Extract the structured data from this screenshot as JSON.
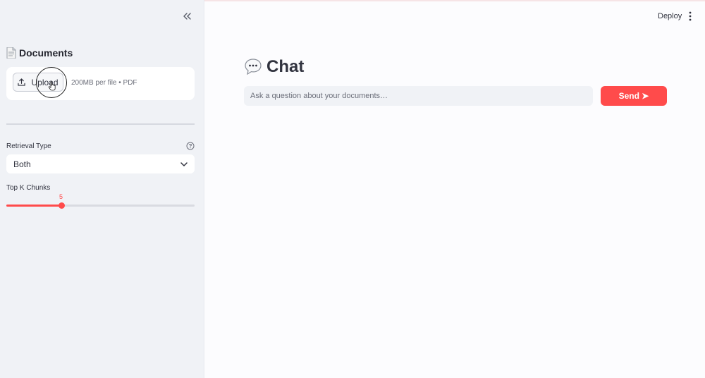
{
  "colors": {
    "accent": "#ff4b4b",
    "sidebar_bg": "#f0f2f6",
    "main_bg": "#fcfcfe",
    "text": "#31333f"
  },
  "sidebar": {
    "collapse_icon": "double-chevron-left-icon",
    "documents": {
      "icon": "page-facing-up-emoji",
      "title": "Documents"
    },
    "uploader": {
      "button_icon": "upload-icon",
      "button_label": "Upload",
      "hint": "200MB per file • PDF"
    },
    "retrieval": {
      "label": "Retrieval Type",
      "help_icon": "help-circle-icon",
      "selected": "Both",
      "chevron_icon": "chevron-down-icon"
    },
    "top_k": {
      "label": "Top K Chunks",
      "value": "5",
      "fill_fraction": 0.29
    }
  },
  "header": {
    "deploy_label": "Deploy",
    "menu_icon": "kebab-menu-icon"
  },
  "main": {
    "title_icon": "speech-balloon-emoji",
    "title": "Chat",
    "input_placeholder": "Ask a question about your documents…",
    "send_label": "Send ➤"
  }
}
